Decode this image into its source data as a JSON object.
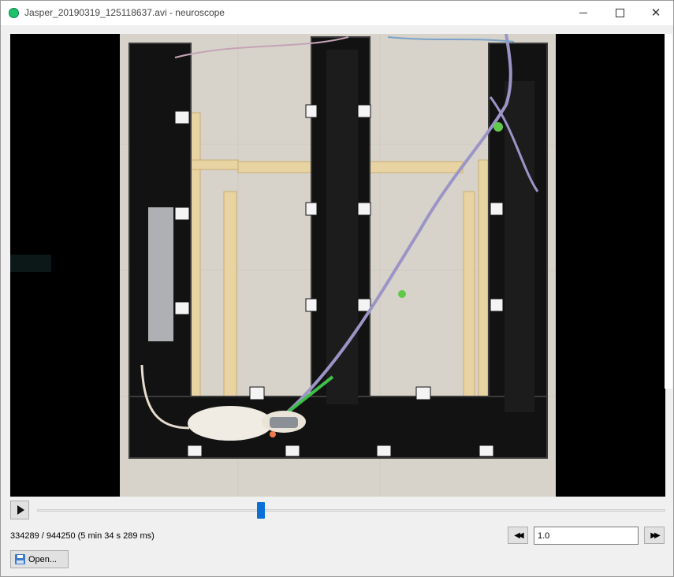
{
  "window": {
    "title": "Jasper_20190319_125118637.avi - neuroscope",
    "controls": {
      "minimize": "—",
      "maximize": "☐",
      "close": "✕"
    }
  },
  "video": {
    "description_icon": "video-frame",
    "progress_fraction": 0.354
  },
  "playback": {
    "play_icon": "play-icon",
    "position_text": "334289 / 944250 (5 min 34 s 289 ms)",
    "rewind_label": "◀◀",
    "fast_forward_label": "▶▶",
    "speed_value": "1.0"
  },
  "toolbar": {
    "open_label": "Open...",
    "open_icon": "save-disk-icon"
  },
  "colors": {
    "accent": "#0a70d6",
    "app_icon": "#19c26b"
  }
}
